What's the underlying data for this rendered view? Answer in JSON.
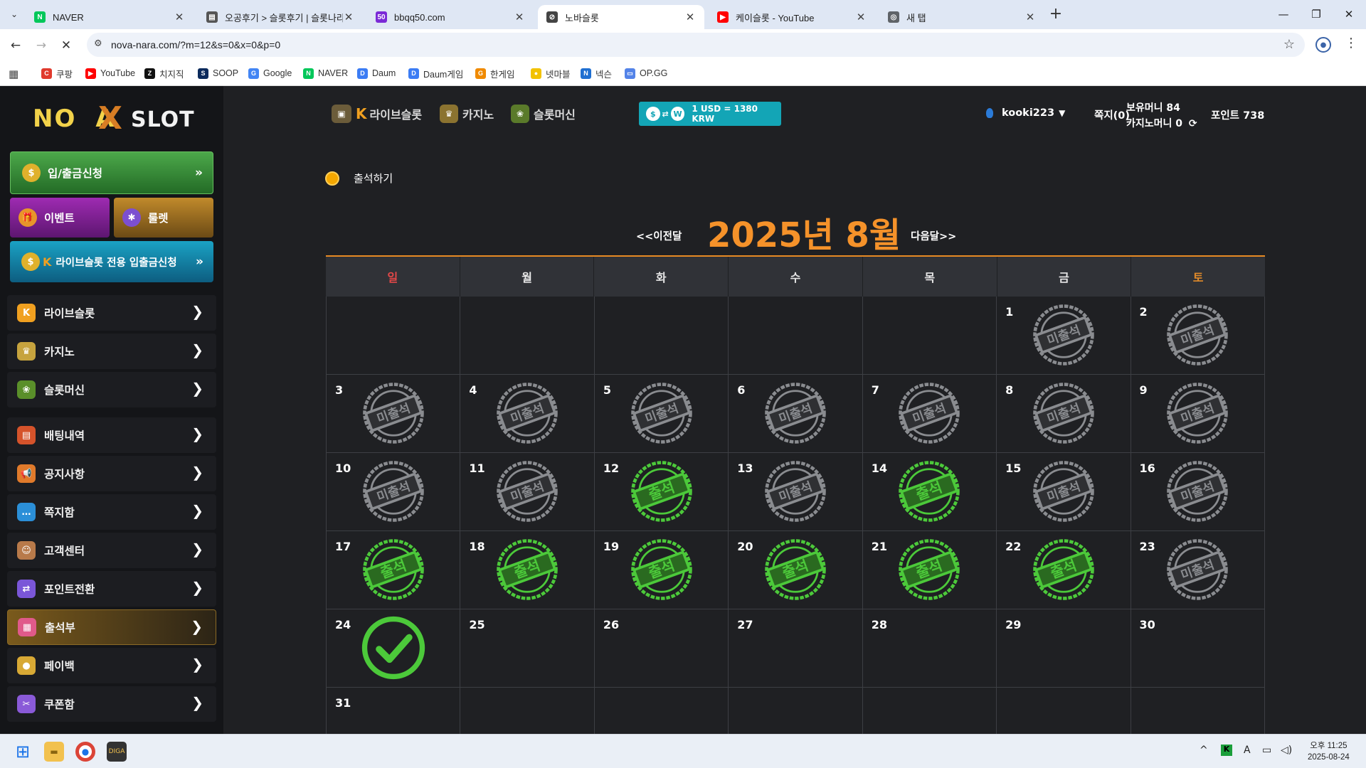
{
  "browser": {
    "tabs": [
      {
        "title": "NAVER",
        "favicon_text": "N",
        "favicon_color": "#03c75a"
      },
      {
        "title": "오공후기 > 슬롯후기 | 슬롯나라",
        "favicon_text": "▤",
        "favicon_color": "#555555"
      },
      {
        "title": "bbqq50.com",
        "favicon_text": "50",
        "favicon_color": "#7b2ad6"
      },
      {
        "title": "노바슬롯",
        "favicon_text": "⊘",
        "favicon_color": "#444444"
      },
      {
        "title": "케이슬롯 - YouTube",
        "favicon_text": "▶",
        "favicon_color": "#ff0000"
      },
      {
        "title": "새 탭",
        "favicon_text": "◎",
        "favicon_color": "#5f6368"
      }
    ],
    "active_tab_index": 3,
    "url": "nova-nara.com/?m=12&s=0&x=0&p=0",
    "bookmarks": [
      {
        "label": "쿠팡",
        "icon_text": "C",
        "color": "#e03a2d"
      },
      {
        "label": "YouTube",
        "icon_text": "▶",
        "color": "#ff0000"
      },
      {
        "label": "치지직",
        "icon_text": "Z",
        "color": "#111111"
      },
      {
        "label": "SOOP",
        "icon_text": "S",
        "color": "#0b2a5c"
      },
      {
        "label": "Google",
        "icon_text": "G",
        "color": "#4285f4"
      },
      {
        "label": "NAVER",
        "icon_text": "N",
        "color": "#03c75a"
      },
      {
        "label": "Daum",
        "icon_text": "D",
        "color": "#3b7cf4"
      },
      {
        "label": "Daum게임",
        "icon_text": "D",
        "color": "#3b7cf4"
      },
      {
        "label": "한게임",
        "icon_text": "G",
        "color": "#f08a00"
      },
      {
        "label": "넷마블",
        "icon_text": "●",
        "color": "#f2c200"
      },
      {
        "label": "넥슨",
        "icon_text": "N",
        "color": "#1f6fd1"
      },
      {
        "label": "OP.GG",
        "icon_text": "▭",
        "color": "#5383e8"
      }
    ]
  },
  "site": {
    "logo": {
      "part1": "NO",
      "part2": "X",
      "part3": "A",
      "part4": "SLOT"
    },
    "sidebar": {
      "deposit_label": "입/출금신청",
      "event_label": "이벤트",
      "roulette_label": "룰렛",
      "live_deposit_label": "라이브슬롯 전용 입출금신청",
      "menu": [
        {
          "label": "라이브슬롯",
          "icon": "k-logo-icon",
          "glyph": "K",
          "color": "#f0a020"
        },
        {
          "label": "카지노",
          "icon": "casino-crown-icon",
          "glyph": "♛",
          "color": "#c6a33e"
        },
        {
          "label": "슬롯머신",
          "icon": "slot-machine-icon",
          "glyph": "❀",
          "color": "#5a8f2a"
        },
        {
          "label": "배팅내역",
          "icon": "bet-history-icon",
          "glyph": "▤",
          "color": "#d5532b"
        },
        {
          "label": "공지사항",
          "icon": "megaphone-icon",
          "glyph": "📢",
          "color": "#e07a2b"
        },
        {
          "label": "쪽지함",
          "icon": "chat-icon",
          "glyph": "…",
          "color": "#2b8fd8"
        },
        {
          "label": "고객센터",
          "icon": "support-agent-icon",
          "glyph": "☺",
          "color": "#b87a4a"
        },
        {
          "label": "포인트전환",
          "icon": "exchange-icon",
          "glyph": "⇄",
          "color": "#7a56d8"
        },
        {
          "label": "출석부",
          "icon": "calendar-icon",
          "glyph": "▦",
          "color": "#e05a8a"
        },
        {
          "label": "페이백",
          "icon": "coin-icon",
          "glyph": "●",
          "color": "#d8a935"
        },
        {
          "label": "쿠폰함",
          "icon": "coupon-icon",
          "glyph": "✂",
          "color": "#8a5ad8"
        }
      ],
      "active_menu_index": 8
    },
    "topnav": {
      "games": [
        {
          "label": "라이브슬롯",
          "icon": "live-slot-icon"
        },
        {
          "label": "카지노",
          "icon": "casino-icon"
        },
        {
          "label": "슬롯머신",
          "icon": "slot-machine-icon"
        }
      ],
      "rate_text": "1 USD = 1380 KRW",
      "rate_icon_left": "$",
      "rate_icon_right": "W",
      "username": "kooki223",
      "messages": "쪽지(0)",
      "money_label": "보유머니 84",
      "casino_money_label": "카지노머니 0",
      "points_label": "포인트 738"
    },
    "attendance": {
      "title": "출석하기",
      "prev": "<<이전달",
      "next": "다음달>>",
      "month_title": "2025년 8월",
      "weekdays": [
        "일",
        "월",
        "화",
        "수",
        "목",
        "금",
        "토"
      ],
      "stamp_attended": "출석",
      "stamp_absent": "미출석",
      "weeks": [
        [
          {
            "d": ""
          },
          {
            "d": ""
          },
          {
            "d": ""
          },
          {
            "d": ""
          },
          {
            "d": ""
          },
          {
            "d": "1",
            "s": "absent"
          },
          {
            "d": "2",
            "s": "absent"
          }
        ],
        [
          {
            "d": "3",
            "s": "absent"
          },
          {
            "d": "4",
            "s": "absent"
          },
          {
            "d": "5",
            "s": "absent"
          },
          {
            "d": "6",
            "s": "absent"
          },
          {
            "d": "7",
            "s": "absent"
          },
          {
            "d": "8",
            "s": "absent"
          },
          {
            "d": "9",
            "s": "absent"
          }
        ],
        [
          {
            "d": "10",
            "s": "absent"
          },
          {
            "d": "11",
            "s": "absent"
          },
          {
            "d": "12",
            "s": "attended"
          },
          {
            "d": "13",
            "s": "absent"
          },
          {
            "d": "14",
            "s": "attended"
          },
          {
            "d": "15",
            "s": "absent"
          },
          {
            "d": "16",
            "s": "absent"
          }
        ],
        [
          {
            "d": "17",
            "s": "attended"
          },
          {
            "d": "18",
            "s": "attended"
          },
          {
            "d": "19",
            "s": "attended"
          },
          {
            "d": "20",
            "s": "attended"
          },
          {
            "d": "21",
            "s": "attended"
          },
          {
            "d": "22",
            "s": "attended"
          },
          {
            "d": "23",
            "s": "absent"
          }
        ],
        [
          {
            "d": "24",
            "s": "check"
          },
          {
            "d": "25"
          },
          {
            "d": "26"
          },
          {
            "d": "27"
          },
          {
            "d": "28"
          },
          {
            "d": "29"
          },
          {
            "d": "30"
          }
        ],
        [
          {
            "d": "31"
          },
          {
            "d": ""
          },
          {
            "d": ""
          },
          {
            "d": ""
          },
          {
            "d": ""
          },
          {
            "d": ""
          },
          {
            "d": ""
          }
        ]
      ]
    }
  },
  "taskbar": {
    "time": "오후 11:25",
    "date": "2025-08-24"
  },
  "colors": {
    "accent_orange": "#f5922a",
    "attended_green": "#4cc93a",
    "absent_gray": "#8a8c90"
  }
}
